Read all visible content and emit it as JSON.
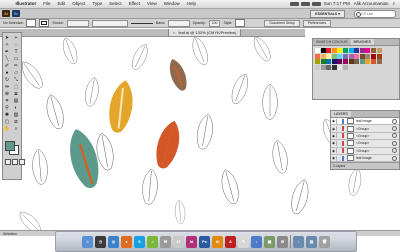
{
  "menubar": {
    "apple_glyph": "",
    "items": [
      "Illustrator",
      "File",
      "Edit",
      "Object",
      "Type",
      "Select",
      "Effect",
      "View",
      "Window",
      "Help"
    ],
    "clock": "Sun 7:17 PM",
    "user": "Alik Arzoumanian"
  },
  "appbar": {
    "logo": "Ai",
    "bridge": "Br",
    "workspace": "ESSENTIALS ▾",
    "search_placeholder": "CS Live"
  },
  "controlbar": {
    "selection_label": "No Selection",
    "stroke_label": "Stroke:",
    "stroke_weight": "",
    "brush_label": "Basic",
    "style_label": "Style:",
    "opacity_label": "Opacity:",
    "opacity_value": "100",
    "doc_setup": "Document Setup",
    "preferences": "Preferences"
  },
  "document": {
    "tab_label": "leaf.ai @ 133% (CMYK/Preview)",
    "close_glyph": "×"
  },
  "panels": {
    "swatches_tabs": [
      "SWATCH COLOUR",
      "BRUSHES"
    ],
    "layers_tab": "LAYERS",
    "layers": [
      {
        "name": "leaf image",
        "color": "#4a78d8"
      },
      {
        "name": "<Group>",
        "color": "#d04848"
      },
      {
        "name": "<Group>",
        "color": "#d04848"
      },
      {
        "name": "<Group>",
        "color": "#d04848"
      },
      {
        "name": "<Group>",
        "color": "#d04848"
      },
      {
        "name": "leaf image",
        "color": "#4a78d8"
      }
    ],
    "layers_footer": "2 Layers"
  },
  "statusbar": {
    "text": "Selection"
  },
  "colors": {
    "leaf_green": "#5c9a8b",
    "leaf_yellow": "#e3a52a",
    "leaf_orange": "#d2582a",
    "leaf_brown": "#8e6b4e",
    "midrib_light": "#f3e7b8",
    "midrib_dark": "#e25a1c"
  },
  "dock": {
    "apps": [
      {
        "name": "finder",
        "label": "☺",
        "color": "#5a8fd6"
      },
      {
        "name": "dashboard",
        "label": "◷",
        "color": "#3a3a3a"
      },
      {
        "name": "safari",
        "label": "◎",
        "color": "#3b82c8"
      },
      {
        "name": "firefox",
        "label": "●",
        "color": "#e06a20"
      },
      {
        "name": "skype",
        "label": "S",
        "color": "#1aa0e0"
      },
      {
        "name": "spotify",
        "label": "♫",
        "color": "#7ab83a"
      },
      {
        "name": "mail",
        "label": "✉",
        "color": "#9a9a9a"
      },
      {
        "name": "calendar",
        "label": "17",
        "color": "#c9c9c9"
      },
      {
        "name": "indesign",
        "label": "Id",
        "color": "#b0307a"
      },
      {
        "name": "photoshop",
        "label": "Ps",
        "color": "#2a5aa0"
      },
      {
        "name": "illustrator",
        "label": "Ai",
        "color": "#e08a10"
      },
      {
        "name": "acrobat",
        "label": "A",
        "color": "#c02020"
      },
      {
        "name": "textedit",
        "label": "✎",
        "color": "#d8d8d8"
      },
      {
        "name": "itunes",
        "label": "♪",
        "color": "#4f7ac8"
      },
      {
        "name": "preview",
        "label": "▣",
        "color": "#7a9a6a"
      },
      {
        "name": "system-prefs",
        "label": "⚙",
        "color": "#8a8a8a"
      }
    ],
    "trailing": [
      {
        "name": "downloads",
        "label": "↓",
        "color": "#6a8ab0"
      },
      {
        "name": "documents",
        "label": "▤",
        "color": "#6a8ab0"
      },
      {
        "name": "trash",
        "label": "🗑",
        "color": "#a0a0a0"
      }
    ]
  }
}
